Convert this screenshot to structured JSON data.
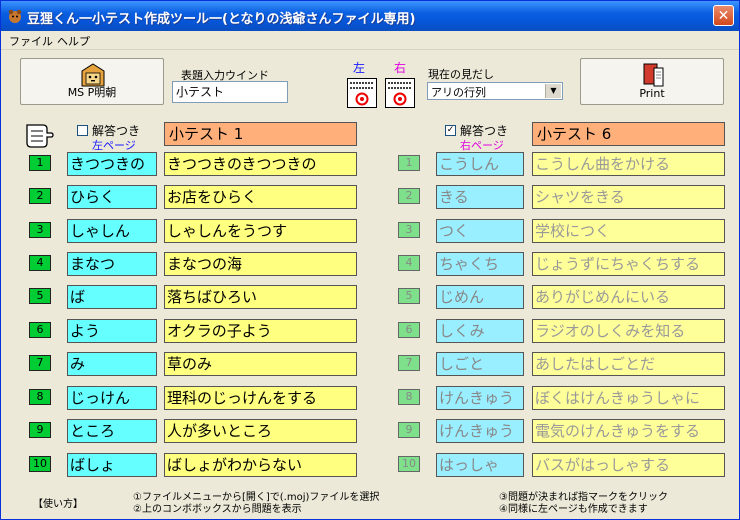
{
  "window": {
    "title": "豆狸くん一小テスト作成ツール一(となりの浅爺さんファイル専用)",
    "close_label": "✕"
  },
  "menu": {
    "file": "ファイル",
    "help": "ヘルプ"
  },
  "toolbar": {
    "font_button": "MS P明朝",
    "title_input_label": "表題入力ウインド",
    "title_input_value": "小テスト",
    "left_label": "左",
    "right_label": "右",
    "heading_label": "現在の見だし",
    "heading_value": "アリの行列",
    "print_button": "Print"
  },
  "left_page": {
    "answer_label": "解答つき",
    "page_label": "左ページ",
    "checked": false,
    "title": "小テスト 1",
    "rows": [
      {
        "num": "1",
        "word": "きつつきの",
        "sentence": "きつつきのきつつきの"
      },
      {
        "num": "2",
        "word": "ひらく",
        "sentence": "お店をひらく"
      },
      {
        "num": "3",
        "word": "しゃしん",
        "sentence": "しゃしんをうつす"
      },
      {
        "num": "4",
        "word": "まなつ",
        "sentence": "まなつの海"
      },
      {
        "num": "5",
        "word": "ば",
        "sentence": "落ちばひろい"
      },
      {
        "num": "6",
        "word": "よう",
        "sentence": "オクラの子よう"
      },
      {
        "num": "7",
        "word": "み",
        "sentence": "草のみ"
      },
      {
        "num": "8",
        "word": "じっけん",
        "sentence": "理科のじっけんをする"
      },
      {
        "num": "9",
        "word": "ところ",
        "sentence": "人が多いところ"
      },
      {
        "num": "10",
        "word": "ばしょ",
        "sentence": "ばしょがわからない"
      }
    ]
  },
  "right_page": {
    "answer_label": "解答つき",
    "page_label": "右ページ",
    "checked": true,
    "check_mark": "✓",
    "title": "小テスト 6",
    "rows": [
      {
        "num": "1",
        "word": "こうしん",
        "sentence": "こうしん曲をかける"
      },
      {
        "num": "2",
        "word": "きる",
        "sentence": "シャツをきる"
      },
      {
        "num": "3",
        "word": "つく",
        "sentence": "学校につく"
      },
      {
        "num": "4",
        "word": "ちゃくち",
        "sentence": "じょうずにちゃくちする"
      },
      {
        "num": "5",
        "word": "じめん",
        "sentence": "ありがじめんにいる"
      },
      {
        "num": "6",
        "word": "しくみ",
        "sentence": "ラジオのしくみを知る"
      },
      {
        "num": "7",
        "word": "しごと",
        "sentence": "あしたはしごとだ"
      },
      {
        "num": "8",
        "word": "けんきゅう",
        "sentence": "ぼくはけんきゅうしゃに"
      },
      {
        "num": "9",
        "word": "けんきゅう",
        "sentence": "電気のけんきゅうをする"
      },
      {
        "num": "10",
        "word": "はっしゃ",
        "sentence": "バスがはっしゃする"
      }
    ]
  },
  "footer": {
    "usage": "【使い方】",
    "step1": "①ファイルメニューから[開く]で(.moj)ファイルを選択",
    "step2": "②上のコンボボックスから問題を表示",
    "step3": "③問題が決まれば指マークをクリック",
    "step4": "④同様に左ページも作成できます"
  }
}
